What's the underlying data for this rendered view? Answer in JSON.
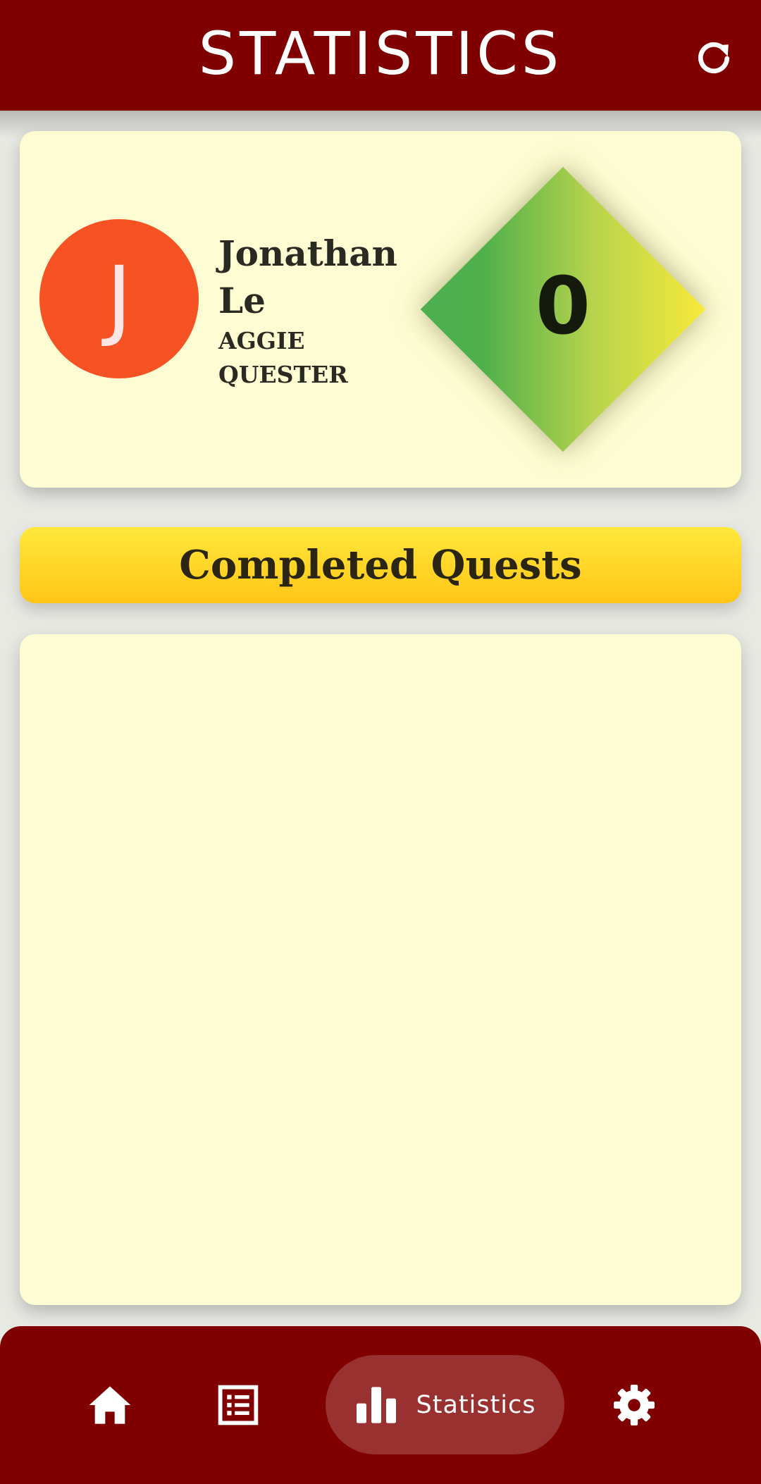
{
  "header": {
    "title": "STATISTICS",
    "refresh_icon": "refresh-icon"
  },
  "profile": {
    "avatar_initial": "J",
    "avatar_color": "#f65223",
    "name": "Jonathan Le",
    "rank": "AGGIE QUESTER",
    "score": "0"
  },
  "quests": {
    "banner_label": "Completed Quests",
    "items": []
  },
  "nav": {
    "items": [
      {
        "icon": "home-icon",
        "label": ""
      },
      {
        "icon": "list-icon",
        "label": ""
      },
      {
        "icon": "bar-chart-icon",
        "label": "Statistics",
        "active": true
      },
      {
        "icon": "gear-icon",
        "label": ""
      }
    ]
  },
  "colors": {
    "header": "#800000",
    "card": "#fefcd2",
    "banner": "#ffd62a",
    "nav_active": "#993131"
  }
}
